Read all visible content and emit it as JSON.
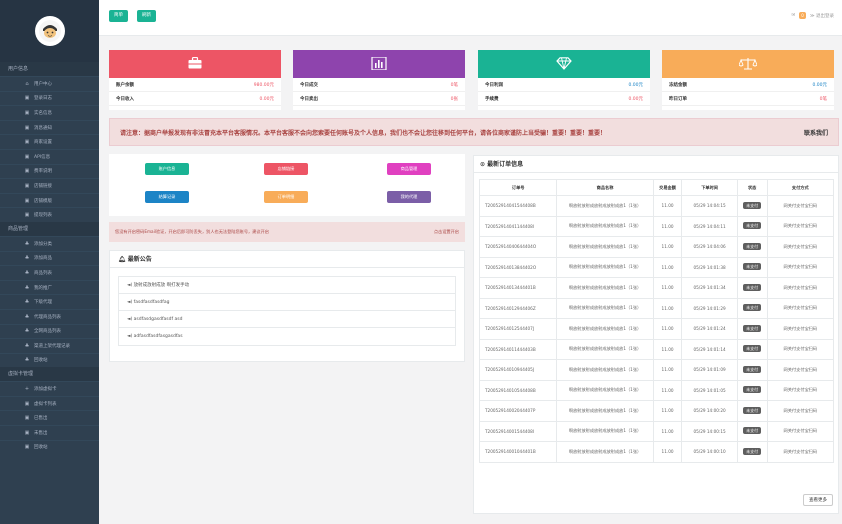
{
  "topbar": {
    "btn1": "简单",
    "btn2": "刷新",
    "badge": "0",
    "logout": "≫ 退出登录"
  },
  "sidebar": {
    "sections": [
      {
        "title": "用户信息",
        "items": [
          "用户中心",
          "登录日志",
          "实名信息",
          "消息通知",
          "商家设置",
          "API信息",
          "费率说明",
          "店铺链接",
          "店铺模版",
          "提现列表"
        ]
      },
      {
        "title": "商品管理",
        "items": [
          "添加分类",
          "添加商品",
          "商品列表",
          "我的推广",
          "下级代理",
          "代理商品列表",
          "全网商品列表",
          "渠道上架代理记录",
          "回收站"
        ]
      },
      {
        "title": "虚拟卡管理",
        "items": [
          "添加虚拟卡",
          "虚拟卡列表",
          "已售出",
          "未售出",
          "回收站"
        ]
      }
    ]
  },
  "cards": [
    {
      "color": "#ed5565",
      "icon": "briefcase-icon",
      "rows": [
        {
          "label": "账户余额",
          "value": "980.00元"
        },
        {
          "label": "今日收入",
          "value": "0.00元"
        }
      ]
    },
    {
      "color": "#8e44ad",
      "icon": "bar-chart-icon",
      "rows": [
        {
          "label": "今日成交",
          "value": "0笔"
        },
        {
          "label": "今日卖出",
          "value": "0张"
        }
      ]
    },
    {
      "color": "#1ab394",
      "icon": "diamond-icon",
      "rows": [
        {
          "label": "今日利润",
          "value": "0.00元"
        },
        {
          "label": "手续费",
          "value": "0.00元"
        }
      ]
    },
    {
      "color": "#f8ac59",
      "icon": "scale-icon",
      "rows": [
        {
          "label": "冻结金额",
          "value": "0.00元"
        },
        {
          "label": "昨日订单",
          "value": "0笔"
        }
      ]
    }
  ],
  "notice": {
    "text": "请注意：据商户举报发现有非法冒充本平台客服情况。本平台客服不会向您索要任何账号及个人信息，我们也不会让您往移到任何平台，请各位商家谨防上当受骗！重要！重要！重要！",
    "link": "联系我们"
  },
  "quick_buttons": [
    {
      "label": "账户信息",
      "color": "#1ab394"
    },
    {
      "label": "店铺链接",
      "color": "#ed5565"
    },
    {
      "label": "商品管理",
      "color": "#e040c0"
    },
    {
      "label": "结算记录",
      "color": "#1c84c6"
    },
    {
      "label": "订单明细",
      "color": "#f8ac59"
    },
    {
      "label": "我的代理",
      "color": "#7b5ea7"
    }
  ],
  "warning": {
    "text": "您没有开启密码Email验证，开启后即可防丢失，别人也无法登陆您账号，建议开启",
    "link": "点击设置开启"
  },
  "announcements": {
    "title": "最新公告",
    "items": [
      "◄) 放射成放射成放 啊打发手动",
      "◄) fasdfasdfasdfag",
      "◄) asdfasdgasdfasdf asd",
      "◄) adfasdfasdfasgasdfas"
    ]
  },
  "orders": {
    "title": "最新订单信息",
    "headers": [
      "订单号",
      "商品名称",
      "交易金额",
      "下单时间",
      "状态",
      "支付方式"
    ],
    "rows": [
      {
        "no": "T20052914041544408B",
        "name": "啊放射放射成放射成放射成放1（1张）",
        "amount": "11.00",
        "time": "05/29 14:04:15",
        "status": "未支付",
        "pay": "网关付支付宝扫码"
      },
      {
        "no": "T20052914041144408I",
        "name": "啊放射放射成放射成放射成放1（1张）",
        "amount": "11.00",
        "time": "05/29 14:04:11",
        "status": "未支付",
        "pay": "网关付支付宝扫码"
      },
      {
        "no": "T20052914040644404O",
        "name": "啊放射放射成放射成放射成放1（1张）",
        "amount": "11.00",
        "time": "05/29 14:04:06",
        "status": "未支付",
        "pay": "网关付支付宝扫码"
      },
      {
        "no": "T20052914013844402O",
        "name": "啊放射放射成放射成放射成放1（1张）",
        "amount": "11.00",
        "time": "05/29 14:01:38",
        "status": "未支付",
        "pay": "网关付支付宝扫码"
      },
      {
        "no": "T20052914013444401B",
        "name": "啊放射放射成放射成放射成放1（1张）",
        "amount": "11.00",
        "time": "05/29 14:01:34",
        "status": "未支付",
        "pay": "网关付支付宝扫码"
      },
      {
        "no": "T20052914012944406Z",
        "name": "啊放射放射成放射成放射成放1（1张）",
        "amount": "11.00",
        "time": "05/29 14:01:29",
        "status": "未支付",
        "pay": "网关付支付宝扫码"
      },
      {
        "no": "T20052914012544407J",
        "name": "啊放射放射成放射成放射成放1（1张）",
        "amount": "11.00",
        "time": "05/29 14:01:24",
        "status": "未支付",
        "pay": "网关付支付宝扫码"
      },
      {
        "no": "T20052914011444403B",
        "name": "啊放射放射成放射成放射成放1（1张）",
        "amount": "11.00",
        "time": "05/29 14:01:14",
        "status": "未支付",
        "pay": "网关付支付宝扫码"
      },
      {
        "no": "T20052914010944405J",
        "name": "啊放射放射成放射成放射成放1（1张）",
        "amount": "11.00",
        "time": "05/29 14:01:09",
        "status": "未支付",
        "pay": "网关付支付宝扫码"
      },
      {
        "no": "T20052914010544408B",
        "name": "啊放射放射成放射成放射成放1（1张）",
        "amount": "11.00",
        "time": "05/29 14:01:05",
        "status": "未支付",
        "pay": "网关付支付宝扫码"
      },
      {
        "no": "T20052914002044407P",
        "name": "啊放射放射成放射成放射成放1（1张）",
        "amount": "11.00",
        "time": "05/29 14:00:20",
        "status": "未支付",
        "pay": "网关付支付宝扫码"
      },
      {
        "no": "T20052914001544408I",
        "name": "啊放射放射成放射成放射成放1（1张）",
        "amount": "11.00",
        "time": "05/29 14:00:15",
        "status": "未支付",
        "pay": "网关付支付宝扫码"
      },
      {
        "no": "T20052914001044401B",
        "name": "啊放射放射成放射成放射成放1（1张）",
        "amount": "11.00",
        "time": "05/29 14:00:10",
        "status": "未支付",
        "pay": "网关付支付宝扫码"
      }
    ],
    "more": "查看更多"
  }
}
